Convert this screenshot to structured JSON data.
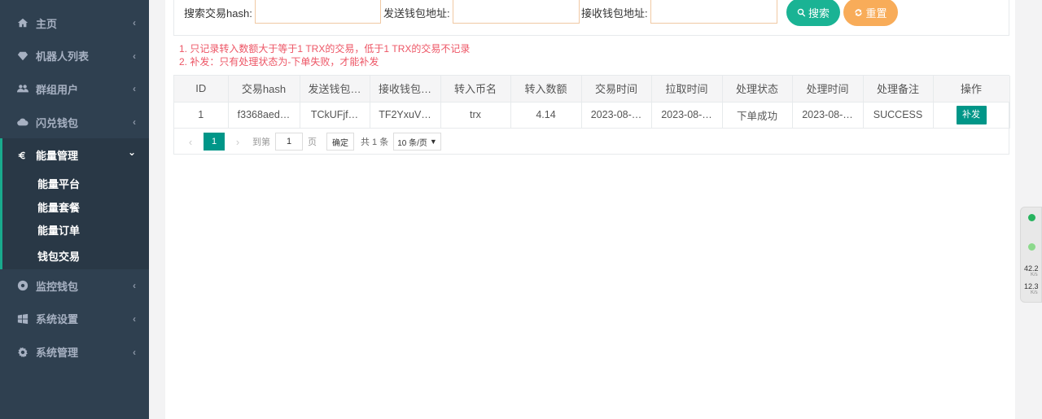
{
  "sidebar": {
    "items": [
      {
        "label": "主页",
        "icon": "home-icon"
      },
      {
        "label": "机器人列表",
        "icon": "diamond-icon"
      },
      {
        "label": "群组用户",
        "icon": "users-icon"
      },
      {
        "label": "闪兑钱包",
        "icon": "cloud-icon"
      }
    ],
    "active_group": {
      "label": "能量管理",
      "icon": "euro-icon",
      "children": [
        "能量平台",
        "能量套餐",
        "能量订单",
        "钱包交易"
      ]
    },
    "items_after": [
      {
        "label": "监控钱包",
        "icon": "chrome-icon"
      },
      {
        "label": "系统设置",
        "icon": "windows-icon"
      },
      {
        "label": "系统管理",
        "icon": "gear-icon"
      }
    ],
    "chevron_collapsed": "‹",
    "chevron_expanded": "⌄"
  },
  "search": {
    "hash_label": "搜索交易hash:",
    "from_label": "发送钱包地址:",
    "to_label": "接收钱包地址:",
    "search_button": "搜索",
    "reset_button": "重置"
  },
  "notes": [
    "1. 只记录转入数额大于等于1 TRX的交易，低于1 TRX的交易不记录",
    "2. 补发：只有处理状态为-下单失败，才能补发"
  ],
  "table": {
    "headers": [
      "ID",
      "交易hash",
      "发送钱包…",
      "接收钱包…",
      "转入币名",
      "转入数额",
      "交易时间",
      "拉取时间",
      "处理状态",
      "处理时间",
      "处理备注",
      "操作"
    ],
    "rows": [
      {
        "id": "1",
        "hash": "f3368aed…",
        "from": "TCkUFjf…",
        "to": "TF2YxuV…",
        "coin": "trx",
        "amount": "4.14",
        "tx_time": "2023-08-…",
        "pull_time": "2023-08-…",
        "status": "下单成功",
        "proc_time": "2023-08-…",
        "remark": "SUCCESS",
        "action": "补发"
      }
    ]
  },
  "pager": {
    "prev": "‹",
    "next": "›",
    "current": "1",
    "goto_label": "到第",
    "goto_value": "1",
    "page_unit": "页",
    "confirm": "确定",
    "total": "共 1 条",
    "page_size": "10 条/页"
  },
  "net_widget": {
    "up_speed": "42.2",
    "up_unit": "K/s",
    "down_speed": "12.3",
    "down_unit": "K/s",
    "dot_color": "#27b35e"
  },
  "colors": {
    "sidebar_bg": "#2f4050",
    "accent": "#1ab394",
    "warning": "#f8ac59",
    "danger_text": "#ed5565",
    "op_button": "#009688"
  }
}
